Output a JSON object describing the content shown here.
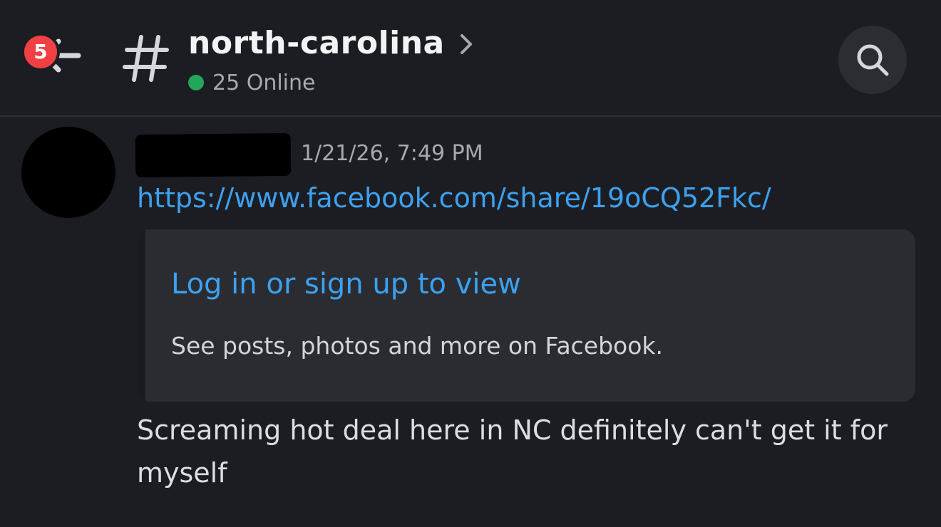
{
  "header": {
    "back_icon": "arrow-left-icon",
    "unread_badge": "5",
    "channel_icon": "hash-icon",
    "channel_name": "north-carolina",
    "chevron_icon": "chevron-right-icon",
    "online_text": "25 Online",
    "online_color": "#23a55a",
    "search_icon": "search-icon"
  },
  "message": {
    "avatar": "redacted",
    "username": "",
    "timestamp": "1/21/26, 7:49 PM",
    "link": "https://www.facebook.com/share/19oCQ52Fkc/",
    "embed": {
      "title": "Log in or sign up to view",
      "description": "See posts, photos and more on Facebook."
    },
    "text": "Screaming hot deal here in NC definitely can't get it for myself"
  },
  "colors": {
    "background": "#1c1d22",
    "link": "#3ca1f0",
    "badge": "#f23f43",
    "embed_bg": "#2b2c32"
  }
}
